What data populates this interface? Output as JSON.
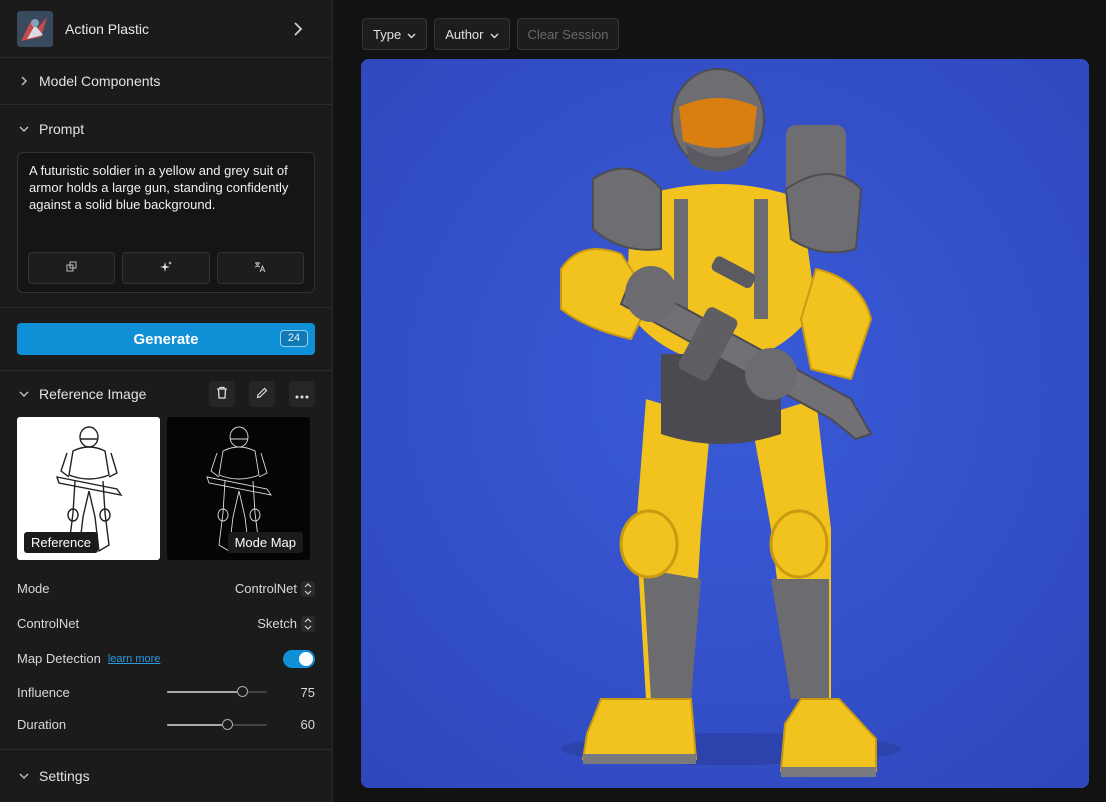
{
  "model": {
    "name": "Action Plastic"
  },
  "sections": {
    "model_components": "Model Components",
    "prompt": "Prompt",
    "reference_image": "Reference Image",
    "settings": "Settings"
  },
  "prompt": {
    "text": "A futuristic soldier in a yellow and grey suit of armor holds a large gun, standing confidently against a solid blue background."
  },
  "generate": {
    "label": "Generate",
    "credits": "24"
  },
  "reference": {
    "tag_reference": "Reference",
    "tag_map": "Mode Map"
  },
  "controls": {
    "mode_label": "Mode",
    "mode_value": "ControlNet",
    "controlnet_label": "ControlNet",
    "controlnet_value": "Sketch",
    "map_detection_label": "Map Detection",
    "learn_more": "learn more",
    "map_detection_on": true,
    "influence_label": "Influence",
    "influence_value": "75",
    "influence_fraction": 0.75,
    "duration_label": "Duration",
    "duration_value": "60",
    "duration_fraction": 0.6
  },
  "toolbar": {
    "type_label": "Type",
    "author_label": "Author",
    "clear_label": "Clear Session"
  },
  "colors": {
    "accent": "#0e8fd6",
    "canvas_bg": "#3552c9",
    "armor_yellow": "#f4c21c",
    "armor_grey": "#6b6b70"
  }
}
